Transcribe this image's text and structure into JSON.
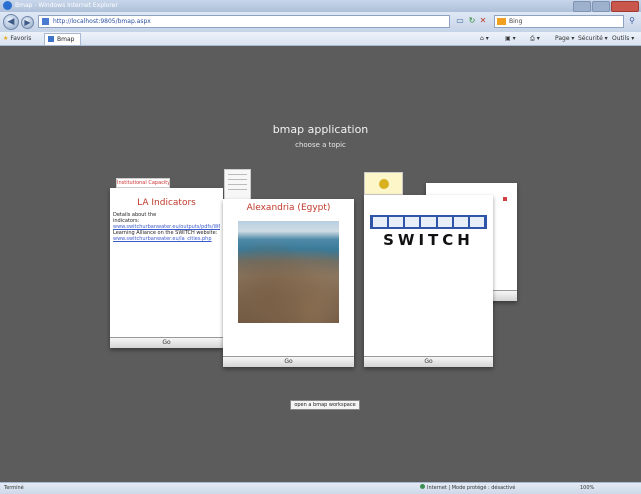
{
  "browser": {
    "window_title": "Bmap - Windows Internet Explorer",
    "address_url": "http://localhost:9805/bmap.aspx",
    "search_placeholder": "Bing",
    "favorites_label": "Favoris",
    "tab_label": "Bmap",
    "commands": [
      "Page ▾",
      "Sécurité ▾",
      "Outils ▾"
    ],
    "status_left": "Terminé",
    "status_zone": "Internet | Mode protégé : désactivé",
    "zoom": "100%"
  },
  "app": {
    "title": "bmap application",
    "subtitle": "choose a topic"
  },
  "cards": {
    "la": {
      "tag": "Institutional Capacity",
      "title": "LA Indicators",
      "details_line1": "Details about the",
      "details_line2": "indicators:",
      "link1": "www.switchurbanwater.eu/outputs/pdfs/W6",
      "text2": "Learning Alliance on the SWITCH website:",
      "link2": "www.switchurbanwater.eu/la_cities.php",
      "go": "Go"
    },
    "alexandria": {
      "title": "Alexandria (Egypt)",
      "go": "Go"
    },
    "switch": {
      "logo_word": "SWITCH",
      "go": "Go"
    }
  },
  "open_button": "open a bmap workspace"
}
